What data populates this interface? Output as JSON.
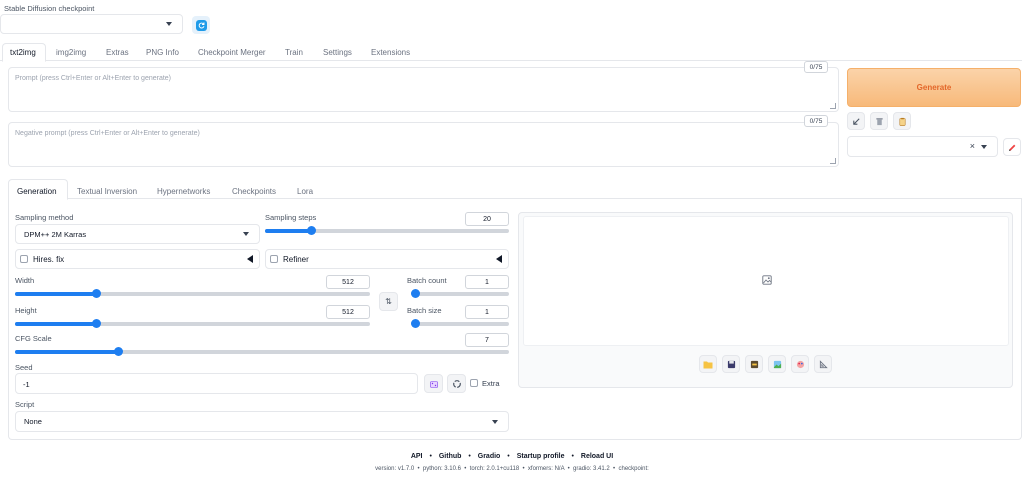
{
  "checkpoint": {
    "label": "Stable Diffusion checkpoint",
    "value": ""
  },
  "main_tabs": [
    {
      "label": "txt2img"
    },
    {
      "label": "img2img"
    },
    {
      "label": "Extras"
    },
    {
      "label": "PNG Info"
    },
    {
      "label": "Checkpoint Merger"
    },
    {
      "label": "Train"
    },
    {
      "label": "Settings"
    },
    {
      "label": "Extensions"
    }
  ],
  "prompt": {
    "placeholder": "Prompt (press Ctrl+Enter or Alt+Enter to generate)",
    "counter": "0/75"
  },
  "negative_prompt": {
    "placeholder": "Negative prompt (press Ctrl+Enter or Alt+Enter to generate)",
    "counter": "0/75"
  },
  "generate": {
    "label": "Generate",
    "color": "#f28c28"
  },
  "style_select": {
    "value": "",
    "clear_symbol": "×"
  },
  "sub_tabs": [
    {
      "label": "Generation"
    },
    {
      "label": "Textual Inversion"
    },
    {
      "label": "Hypernetworks"
    },
    {
      "label": "Checkpoints"
    },
    {
      "label": "Lora"
    }
  ],
  "sampling_method": {
    "label": "Sampling method",
    "value": "DPM++ 2M Karras"
  },
  "sampling_steps": {
    "label": "Sampling steps",
    "value": "20",
    "fraction": 0.19
  },
  "hires": {
    "label": "Hires. fix"
  },
  "refiner": {
    "label": "Refiner"
  },
  "width": {
    "label": "Width",
    "value": "512",
    "fraction": 0.23
  },
  "height": {
    "label": "Height",
    "value": "512",
    "fraction": 0.23
  },
  "batch_count": {
    "label": "Batch count",
    "value": "1",
    "fraction": 0.0
  },
  "batch_size": {
    "label": "Batch size",
    "value": "1",
    "fraction": 0.0
  },
  "swap_symbol": "⇅",
  "cfg_scale": {
    "label": "CFG Scale",
    "value": "7",
    "fraction": 0.21
  },
  "seed": {
    "label": "Seed",
    "value": "-1",
    "extra_label": "Extra"
  },
  "script": {
    "label": "Script",
    "value": "None"
  },
  "footer": {
    "links": [
      "API",
      "Github",
      "Gradio",
      "Startup profile",
      "Reload UI"
    ],
    "separator": "•",
    "version_line": "version: v1.7.0  •  python: 3.10.6  •  torch: 2.0.1+cu118  •  xformers: N/A  •  gradio: 3.41.2  •  checkpoint:"
  },
  "accent_color": "#1e7ef0"
}
